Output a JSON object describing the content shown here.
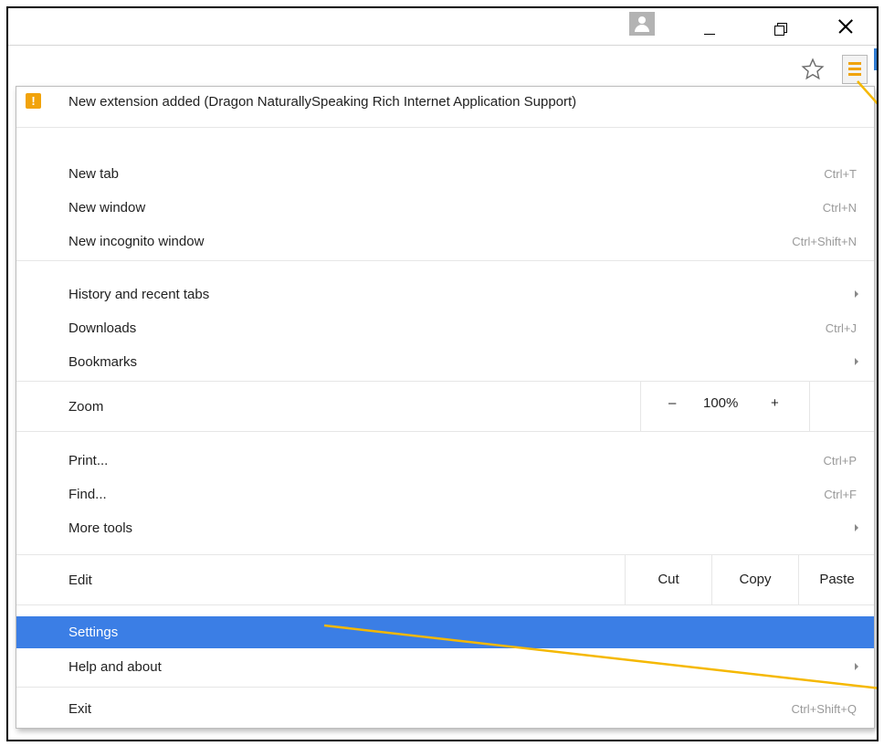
{
  "menu": {
    "extension_notice": "New extension added (Dragon NaturallySpeaking Rich Internet Application Support)",
    "items": {
      "new_tab": {
        "label": "New tab",
        "shortcut": "Ctrl+T"
      },
      "new_window": {
        "label": "New window",
        "shortcut": "Ctrl+N"
      },
      "new_incognito": {
        "label": "New incognito window",
        "shortcut": "Ctrl+Shift+N"
      },
      "history": {
        "label": "History and recent tabs"
      },
      "downloads": {
        "label": "Downloads",
        "shortcut": "Ctrl+J"
      },
      "bookmarks": {
        "label": "Bookmarks"
      },
      "print": {
        "label": "Print...",
        "shortcut": "Ctrl+P"
      },
      "find": {
        "label": "Find...",
        "shortcut": "Ctrl+F"
      },
      "more_tools": {
        "label": "More tools"
      },
      "settings": {
        "label": "Settings"
      },
      "help": {
        "label": "Help and about"
      },
      "exit": {
        "label": "Exit",
        "shortcut": "Ctrl+Shift+Q"
      }
    },
    "zoom": {
      "label": "Zoom",
      "minus": "–",
      "value": "100%",
      "plus": "+"
    },
    "edit": {
      "label": "Edit",
      "cut": "Cut",
      "copy": "Copy",
      "paste": "Paste"
    }
  },
  "colors": {
    "highlight": "#3b7ee5",
    "accent": "#f0a30a",
    "annotation": "#f5b800"
  },
  "icons": [
    "profile-icon",
    "minimize-icon",
    "restore-icon",
    "close-icon",
    "star-icon",
    "hamburger-menu-icon",
    "warning-icon",
    "fullscreen-icon",
    "submenu-arrow-icon"
  ]
}
